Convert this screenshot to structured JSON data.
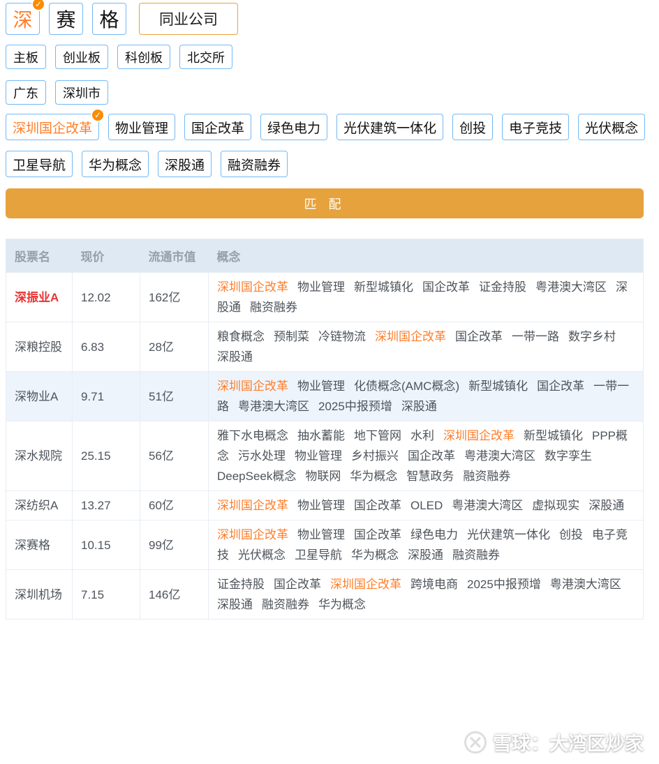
{
  "keyword": {
    "chars": [
      {
        "label": "深",
        "selected": true
      },
      {
        "label": "赛",
        "selected": false
      },
      {
        "label": "格",
        "selected": false
      }
    ],
    "peer_button": "同业公司"
  },
  "markets": [
    "主板",
    "创业板",
    "科创板",
    "北交所"
  ],
  "regions": [
    "广东",
    "深圳市"
  ],
  "concepts": [
    {
      "label": "深圳国企改革",
      "selected": true
    },
    {
      "label": "物业管理"
    },
    {
      "label": "国企改革"
    },
    {
      "label": "绿色电力"
    },
    {
      "label": "光伏建筑一体化"
    },
    {
      "label": "创投"
    },
    {
      "label": "电子竞技"
    },
    {
      "label": "光伏概念"
    },
    {
      "label": "卫星导航"
    },
    {
      "label": "华为概念"
    },
    {
      "label": "深股通"
    },
    {
      "label": "融资融券"
    }
  ],
  "match_button": "匹 配",
  "table": {
    "headers": [
      "股票名",
      "现价",
      "流通市值",
      "概念"
    ],
    "rows": [
      {
        "name": "深振业A",
        "red": true,
        "alt": false,
        "price": "12.02",
        "cap": "162亿",
        "concepts": [
          {
            "t": "深圳国企改革",
            "hl": true
          },
          {
            "t": "物业管理"
          },
          {
            "t": "新型城镇化"
          },
          {
            "t": "国企改革"
          },
          {
            "t": "证金持股"
          },
          {
            "t": "粤港澳大湾区"
          },
          {
            "t": "深股通"
          },
          {
            "t": "融资融券"
          }
        ]
      },
      {
        "name": "深粮控股",
        "red": false,
        "alt": false,
        "price": "6.83",
        "cap": "28亿",
        "concepts": [
          {
            "t": "粮食概念"
          },
          {
            "t": "预制菜"
          },
          {
            "t": "冷链物流"
          },
          {
            "t": "深圳国企改革",
            "hl": true
          },
          {
            "t": "国企改革"
          },
          {
            "t": "一带一路"
          },
          {
            "t": "数字乡村"
          },
          {
            "t": "深股通"
          }
        ]
      },
      {
        "name": "深物业A",
        "red": false,
        "alt": true,
        "price": "9.71",
        "cap": "51亿",
        "concepts": [
          {
            "t": "深圳国企改革",
            "hl": true
          },
          {
            "t": "物业管理"
          },
          {
            "t": "化债概念(AMC概念)"
          },
          {
            "t": "新型城镇化"
          },
          {
            "t": "国企改革"
          },
          {
            "t": "一带一路"
          },
          {
            "t": "粤港澳大湾区"
          },
          {
            "t": "2025中报预增"
          },
          {
            "t": "深股通"
          }
        ]
      },
      {
        "name": "深水规院",
        "red": false,
        "alt": false,
        "price": "25.15",
        "cap": "56亿",
        "concepts": [
          {
            "t": "雅下水电概念"
          },
          {
            "t": "抽水蓄能"
          },
          {
            "t": "地下管网"
          },
          {
            "t": "水利"
          },
          {
            "t": "深圳国企改革",
            "hl": true
          },
          {
            "t": "新型城镇化"
          },
          {
            "t": "PPP概念"
          },
          {
            "t": "污水处理"
          },
          {
            "t": "物业管理"
          },
          {
            "t": "乡村振兴"
          },
          {
            "t": "国企改革"
          },
          {
            "t": "粤港澳大湾区"
          },
          {
            "t": "数字孪生"
          },
          {
            "t": "DeepSeek概念"
          },
          {
            "t": "物联网"
          },
          {
            "t": "华为概念"
          },
          {
            "t": "智慧政务"
          },
          {
            "t": "融资融券"
          }
        ]
      },
      {
        "name": "深纺织A",
        "red": false,
        "alt": false,
        "price": "13.27",
        "cap": "60亿",
        "concepts": [
          {
            "t": "深圳国企改革",
            "hl": true
          },
          {
            "t": "物业管理"
          },
          {
            "t": "国企改革"
          },
          {
            "t": "OLED"
          },
          {
            "t": "粤港澳大湾区"
          },
          {
            "t": "虚拟现实"
          },
          {
            "t": "深股通"
          }
        ]
      },
      {
        "name": "深赛格",
        "red": false,
        "alt": false,
        "price": "10.15",
        "cap": "99亿",
        "concepts": [
          {
            "t": "深圳国企改革",
            "hl": true
          },
          {
            "t": "物业管理"
          },
          {
            "t": "国企改革"
          },
          {
            "t": "绿色电力"
          },
          {
            "t": "光伏建筑一体化"
          },
          {
            "t": "创投"
          },
          {
            "t": "电子竞技"
          },
          {
            "t": "光伏概念"
          },
          {
            "t": "卫星导航"
          },
          {
            "t": "华为概念"
          },
          {
            "t": "深股通"
          },
          {
            "t": "融资融券"
          }
        ]
      },
      {
        "name": "深圳机场",
        "red": false,
        "alt": false,
        "price": "7.15",
        "cap": "146亿",
        "concepts": [
          {
            "t": "证金持股"
          },
          {
            "t": "国企改革"
          },
          {
            "t": "深圳国企改革",
            "hl": true
          },
          {
            "t": "跨境电商"
          },
          {
            "t": "2025中报预增"
          },
          {
            "t": "粤港澳大湾区"
          },
          {
            "t": "深股通"
          },
          {
            "t": "融资融券"
          },
          {
            "t": "华为概念"
          }
        ]
      }
    ]
  },
  "watermark": {
    "text": "雪球：大湾区炒家"
  },
  "icons": {
    "check_glyph": "✓",
    "selected_badge": "check-icon",
    "watermark_logo": "xueqiu-snowball-icon"
  },
  "colors": {
    "accent_orange": "#ff7e29",
    "badge_orange": "#fb8c00",
    "tag_border_blue": "#74b9f5",
    "match_button_bg": "#e6a23c",
    "stock_red": "#e83333",
    "header_bg": "#dfe9f3",
    "header_text": "#95a0aa",
    "body_text": "#4e545b",
    "alt_row_bg": "#eef4fc"
  }
}
